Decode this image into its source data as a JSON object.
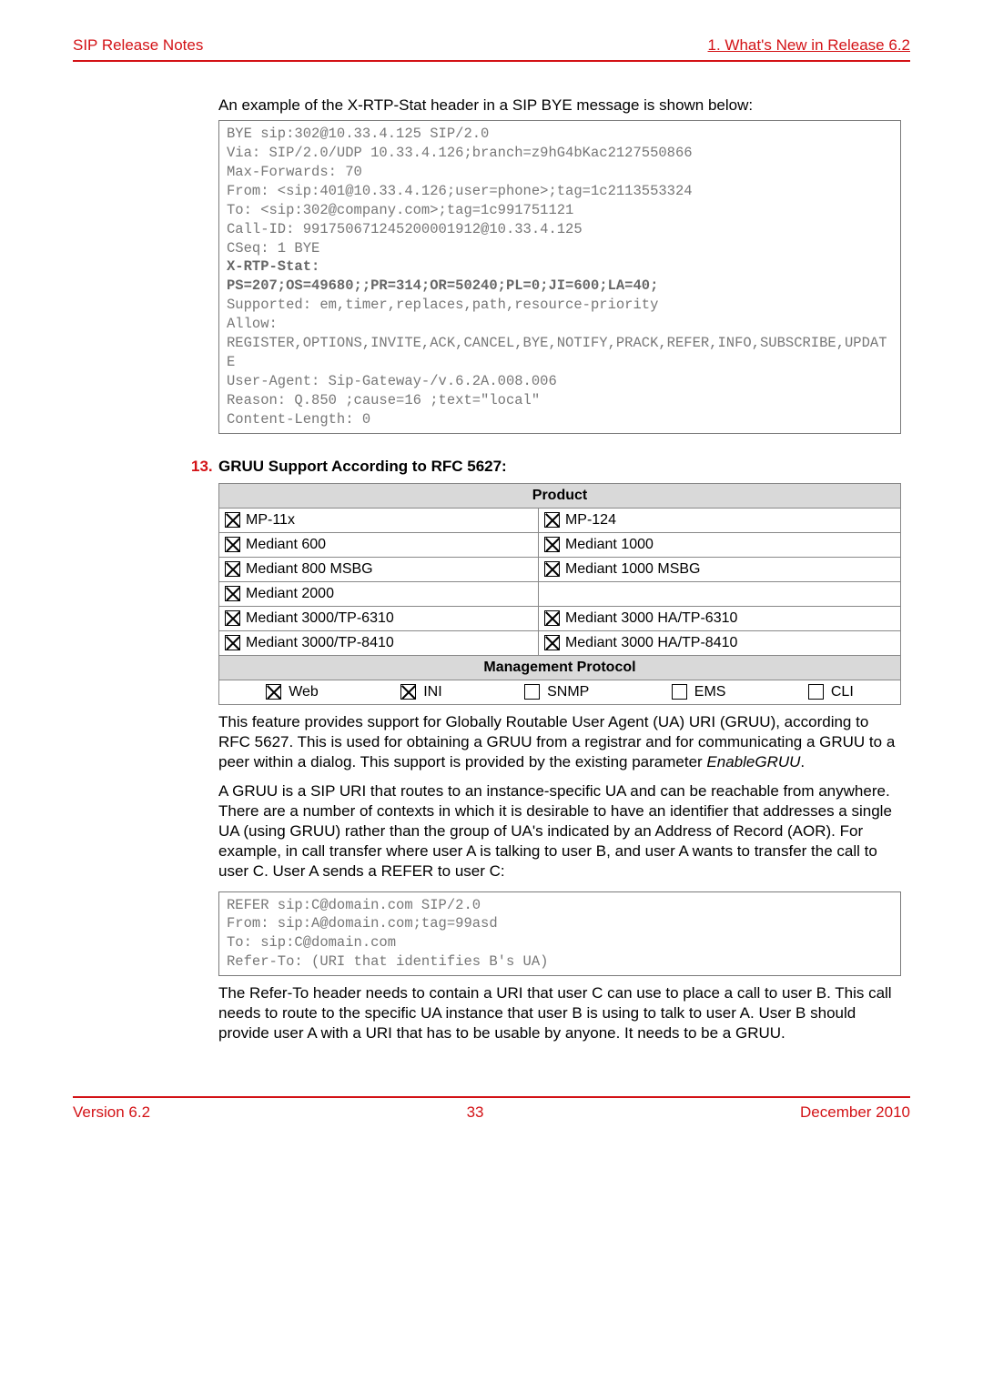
{
  "header": {
    "left": "SIP Release Notes",
    "right": "1. What's New in Release 6.2"
  },
  "intro": "An example of the X-RTP-Stat header in a SIP BYE message is shown below:",
  "code1": {
    "l1": "BYE sip:302@10.33.4.125 SIP/2.0",
    "l2": "Via: SIP/2.0/UDP 10.33.4.126;branch=z9hG4bKac2127550866",
    "l3": "Max-Forwards: 70",
    "l4": "From: <sip:401@10.33.4.126;user=phone>;tag=1c2113553324",
    "l5": "To: <sip:302@company.com>;tag=1c991751121",
    "l6": "Call-ID: 991750671245200001912@10.33.4.125",
    "l7": "CSeq: 1 BYE",
    "l8": "X-RTP-Stat:",
    "l9": "PS=207;OS=49680;;PR=314;OR=50240;PL=0;JI=600;LA=40;",
    "l10": "Supported: em,timer,replaces,path,resource-priority",
    "l11": "Allow:",
    "l12": "REGISTER,OPTIONS,INVITE,ACK,CANCEL,BYE,NOTIFY,PRACK,REFER,INFO,SUBSCRIBE,UPDATE",
    "l13": "User-Agent: Sip-Gateway-/v.6.2A.008.006",
    "l14": "Reason: Q.850 ;cause=16 ;text=\"local\"",
    "l15": "Content-Length: 0"
  },
  "item": {
    "num": "13.",
    "title": "GRUU Support According to RFC 5627:"
  },
  "table": {
    "header_product": "Product",
    "r1a": "MP-11x",
    "r1b": "MP-124",
    "r2a": "Mediant 600",
    "r2b": "Mediant 1000",
    "r3a": "Mediant 800 MSBG",
    "r3b": "Mediant 1000 MSBG",
    "r4a": "Mediant 2000",
    "r5a": "Mediant 3000/TP-6310",
    "r5b": "Mediant 3000 HA/TP-6310",
    "r6a": "Mediant 3000/TP-8410",
    "r6b": "Mediant 3000 HA/TP-8410",
    "header_mgmt": "Management Protocol",
    "m1": "Web",
    "m2": "INI",
    "m3": "SNMP",
    "m4": "EMS",
    "m5": "CLI"
  },
  "para1a": "This feature provides support for Globally Routable User Agent (UA) URI (GRUU), according to RFC 5627. This is used for obtaining a GRUU from a registrar and for communicating a GRUU to a peer within a dialog. This support is provided by the existing parameter ",
  "para1b": "EnableGRUU",
  "para1c": ".",
  "para2": "A GRUU is a SIP URI that routes to an instance-specific UA and can be reachable from anywhere. There are a number of contexts in which it is desirable to have an identifier that addresses a single UA (using GRUU) rather than the group of UA's indicated by an Address of Record (AOR). For example, in call transfer where user A is talking to user B, and user A wants to transfer the call to user C. User A sends a REFER to user C:",
  "code2": {
    "l1": "REFER sip:C@domain.com SIP/2.0",
    "l2": "From: sip:A@domain.com;tag=99asd",
    "l3": "To: sip:C@domain.com",
    "l4": "Refer-To: (URI that identifies B's UA)"
  },
  "para3": "The Refer-To header needs to contain a URI that user C can use to place a call to user B. This call needs to route to the specific UA instance that user B is using to talk to user A. User B should provide user A with a URI that has to be usable by anyone. It needs to be a GRUU.",
  "footer": {
    "left": "Version 6.2",
    "center": "33",
    "right": "December 2010"
  }
}
